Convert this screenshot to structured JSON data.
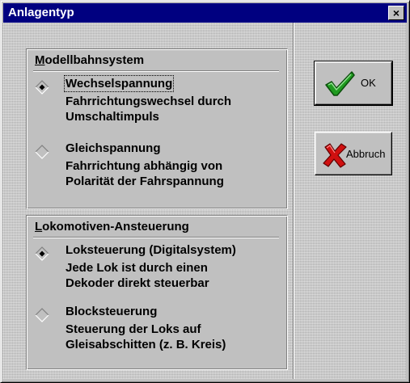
{
  "window": {
    "title": "Anlagentyp",
    "close_label": "×"
  },
  "group_modellbahn": {
    "title_accel": "M",
    "title_rest": "odellbahnsystem",
    "options": [
      {
        "label": "Wechselspannung",
        "desc_line1": "Fahrrichtungswechsel durch",
        "desc_line2": "Umschaltimpuls",
        "selected": true
      },
      {
        "label": "Gleichspannung",
        "desc_line1": "Fahrrichtung abhängig von",
        "desc_line2": "Polarität der Fahrspannung",
        "selected": false
      }
    ]
  },
  "group_lok": {
    "title_accel": "L",
    "title_rest": "okomotiven-Ansteuerung",
    "options": [
      {
        "label": "Loksteuerung (Digitalsystem)",
        "desc_line1": "Jede Lok ist durch einen",
        "desc_line2": "Dekoder direkt steuerbar",
        "selected": true
      },
      {
        "label": "Blocksteuerung",
        "desc_line1": "Steuerung der Loks auf",
        "desc_line2": "Gleisabschitten (z. B. Kreis)",
        "selected": false
      }
    ]
  },
  "buttons": {
    "ok_label": "OK",
    "cancel_label": "Abbruch",
    "ok_icon": "checkmark-icon",
    "cancel_icon": "x-mark-icon"
  },
  "colors": {
    "titlebar": "#000080",
    "face": "#c0c0c0",
    "check_green": "#1f9a1f",
    "x_red": "#d01010"
  }
}
